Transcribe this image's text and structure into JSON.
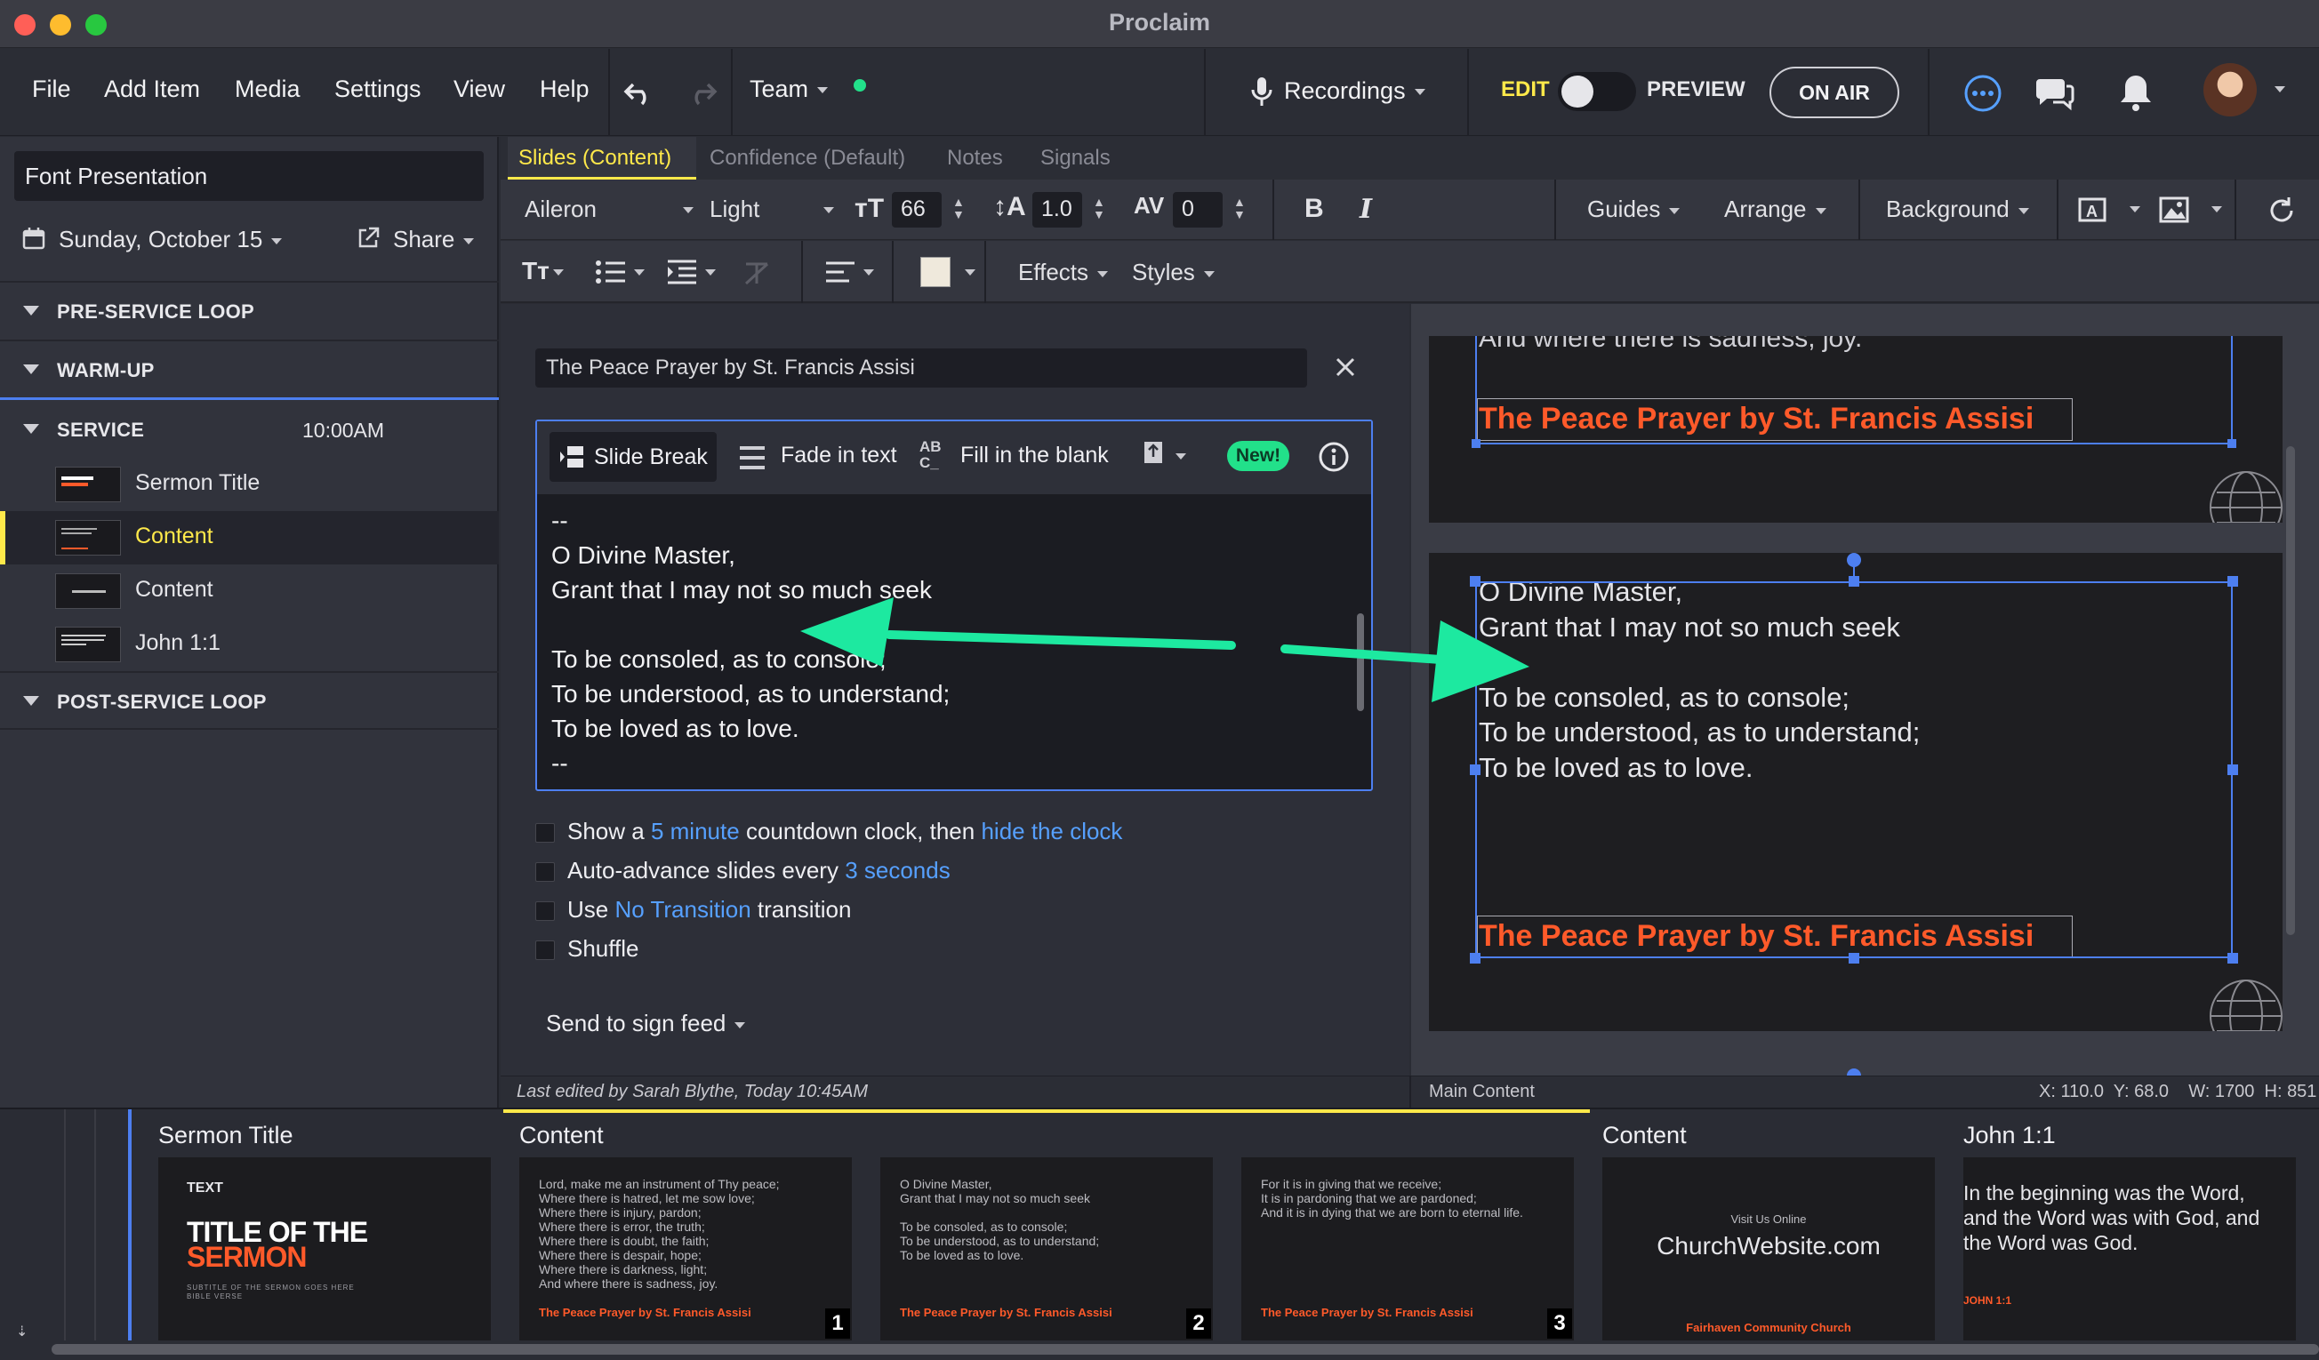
{
  "window": {
    "title": "Proclaim"
  },
  "menu": {
    "file": "File",
    "add_item": "Add Item",
    "media": "Media",
    "settings": "Settings",
    "view": "View",
    "help": "Help",
    "team": "Team",
    "recordings": "Recordings",
    "edit": "EDIT",
    "preview": "PREVIEW",
    "on_air": "ON AIR"
  },
  "sidebar": {
    "presentation_name": "Font Presentation",
    "date": "Sunday, October 15",
    "share": "Share",
    "sections": [
      {
        "label": "PRE-SERVICE LOOP"
      },
      {
        "label": "WARM-UP"
      },
      {
        "label": "SERVICE",
        "time": "10:00AM"
      },
      {
        "label": "POST-SERVICE LOOP"
      }
    ],
    "items": [
      {
        "label": "Sermon Title"
      },
      {
        "label": "Content"
      },
      {
        "label": "Content"
      },
      {
        "label": "John 1:1"
      }
    ]
  },
  "tabs": [
    "Slides (Content)",
    "Confidence (Default)",
    "Notes",
    "Signals"
  ],
  "format": {
    "font": "Aileron",
    "weight": "Light",
    "size": "66",
    "line_height": "1.0",
    "tracking": "0",
    "bold": "B",
    "italic": "I",
    "guides": "Guides",
    "arrange": "Arrange",
    "background": "Background",
    "effects": "Effects",
    "styles": "Styles"
  },
  "editor": {
    "title_value": "The Peace Prayer by St. Francis Assisi",
    "toolbar": {
      "slide_break": "Slide Break",
      "fade_in_text": "Fade in text",
      "fill_in_blank": "Fill in the blank",
      "new_badge": "New!"
    },
    "text": "--\nO Divine Master,\nGrant that I may not so much seek\n\nTo be consoled, as to console;\nTo be understood, as to understand;\nTo be loved as to love.\n--",
    "options": {
      "countdown_prefix": "Show a",
      "countdown_link": "5 minute",
      "countdown_mid": "countdown clock, then",
      "countdown_link2": "hide the clock",
      "advance_prefix": "Auto-advance slides every",
      "advance_link": "3 seconds",
      "transition_prefix": "Use",
      "transition_link": "No Transition",
      "transition_suffix": "transition",
      "shuffle": "Shuffle"
    },
    "send_to_sign": "Send to sign feed"
  },
  "preview": {
    "top_partial_text": "And where there is sadness, joy.",
    "slide_footer": "The Peace Prayer by St. Francis Assisi",
    "main_text": "O Divine Master,\nGrant that I may not so much seek\n\nTo be consoled, as to console;\nTo be understood, as to understand;\nTo be loved as to love."
  },
  "status": {
    "last_edited": "Last edited by Sarah Blythe, Today 10:45AM",
    "layer": "Main Content",
    "geometry": "X: 110.0  Y: 68.0    W: 1700  H: 851"
  },
  "strip": {
    "groups": [
      "Sermon Title",
      "Content",
      "Content",
      "John 1:1"
    ],
    "sermon": {
      "small": "TEXT",
      "title1": "TITLE OF THE",
      "title2": "SERMON",
      "subtitle": "SUBTITLE OF THE SERMON GOES HERE\nBIBLE VERSE"
    },
    "content_slides": [
      {
        "text": "Lord, make me an instrument of Thy peace;\nWhere there is hatred, let me sow love;\nWhere there is injury, pardon;\nWhere there is error, the truth;\nWhere there is doubt, the faith;\nWhere there is despair, hope;\nWhere there is darkness, light;\nAnd where there is sadness, joy.",
        "footer": "The Peace Prayer by St. Francis Assisi",
        "num": "1"
      },
      {
        "text": "O Divine Master,\nGrant that I may not so much seek\n\nTo be consoled, as to console;\nTo be understood, as to understand;\nTo be loved as to love.",
        "footer": "The Peace Prayer by St. Francis Assisi",
        "num": "2"
      },
      {
        "text": "For it is in giving that we receive;\nIt is in pardoning that we are pardoned;\nAnd it is in dying that we are born to eternal life.",
        "footer": "The Peace Prayer by St. Francis Assisi",
        "num": "3"
      }
    ],
    "online": {
      "small": "Visit Us Online",
      "url": "ChurchWebsite.com",
      "church": "Fairhaven Community Church"
    },
    "john": {
      "text": "In the beginning was the Word,\nand the Word was with God, and\nthe Word was God.",
      "ref": "JOHN 1:1"
    }
  },
  "colors": {
    "accent": "#ffe94a",
    "link": "#56a0ff",
    "footer_orange": "#ff5a2a",
    "selection": "#4d7ff0",
    "arrow": "#1de9a0",
    "new_badge": "#22e08a"
  }
}
